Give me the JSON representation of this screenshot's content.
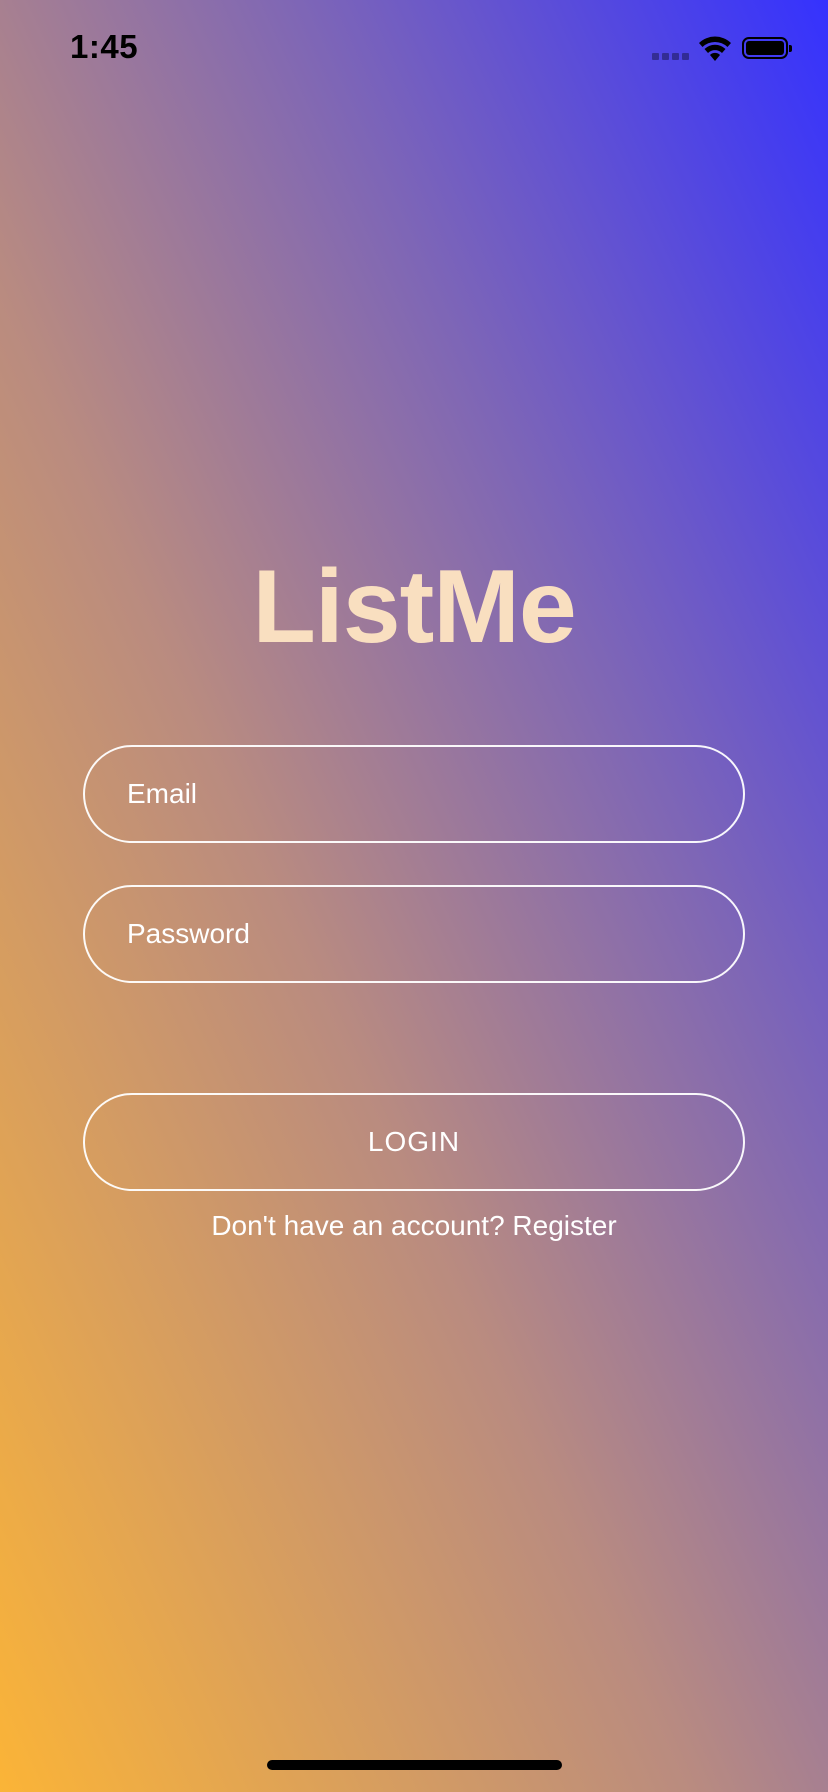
{
  "status_bar": {
    "time": "1:45",
    "signal_icon": "cellular-signal-icon",
    "wifi_icon": "wifi-icon",
    "battery_icon": "battery-icon",
    "battery_level": 1.0
  },
  "app": {
    "title": "ListMe",
    "title_color": "#f9dfc0"
  },
  "form": {
    "email_placeholder": "Email",
    "email_value": "",
    "password_placeholder": "Password",
    "password_value": "",
    "login_label": "LOGIN",
    "register_prompt": "Don't have an account? Register"
  },
  "colors": {
    "gradient_top_right": "#3532fe",
    "gradient_bottom_left": "#fbb437",
    "text": "#ffffff"
  }
}
